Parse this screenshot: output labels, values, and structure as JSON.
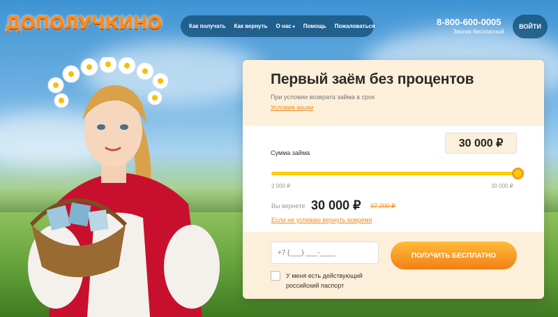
{
  "header": {
    "logo": "ДОПОЛУЧКИНО",
    "nav": [
      {
        "label": "Как получать"
      },
      {
        "label": "Как вернуть"
      },
      {
        "label": "О нас"
      },
      {
        "label": "Помощь"
      },
      {
        "label": "Пожаловаться"
      }
    ],
    "phone": "8-800-600-0005",
    "phone_note": "Звонок бесплатный",
    "login_label": "ВОЙТИ"
  },
  "card": {
    "title": "Первый заём без процентов",
    "subtitle": "При условии возврата займа в срок",
    "promo_link": "Условия акции",
    "sum_label": "Сумма займа",
    "sum_value": "30 000 ₽",
    "slider": {
      "min_label": "2 000 ₽",
      "max_label": "30 000 ₽",
      "value_fraction": 1.0
    },
    "return_label": "Вы вернете",
    "return_value": "30 000 ₽",
    "return_old": "37 200 ₽",
    "cant_return_link": "Если не успеваю вернуть вовремя",
    "phone_placeholder": "+7 (___) ___-____",
    "get_button_label": "ПОЛУЧИТЬ БЕСПЛАТНО",
    "passport_label": "У меня есть действующий российский паспорт"
  },
  "colors": {
    "accent": "#f08a1a",
    "slider": "#ffcc00",
    "nav_bg": "#145078"
  }
}
